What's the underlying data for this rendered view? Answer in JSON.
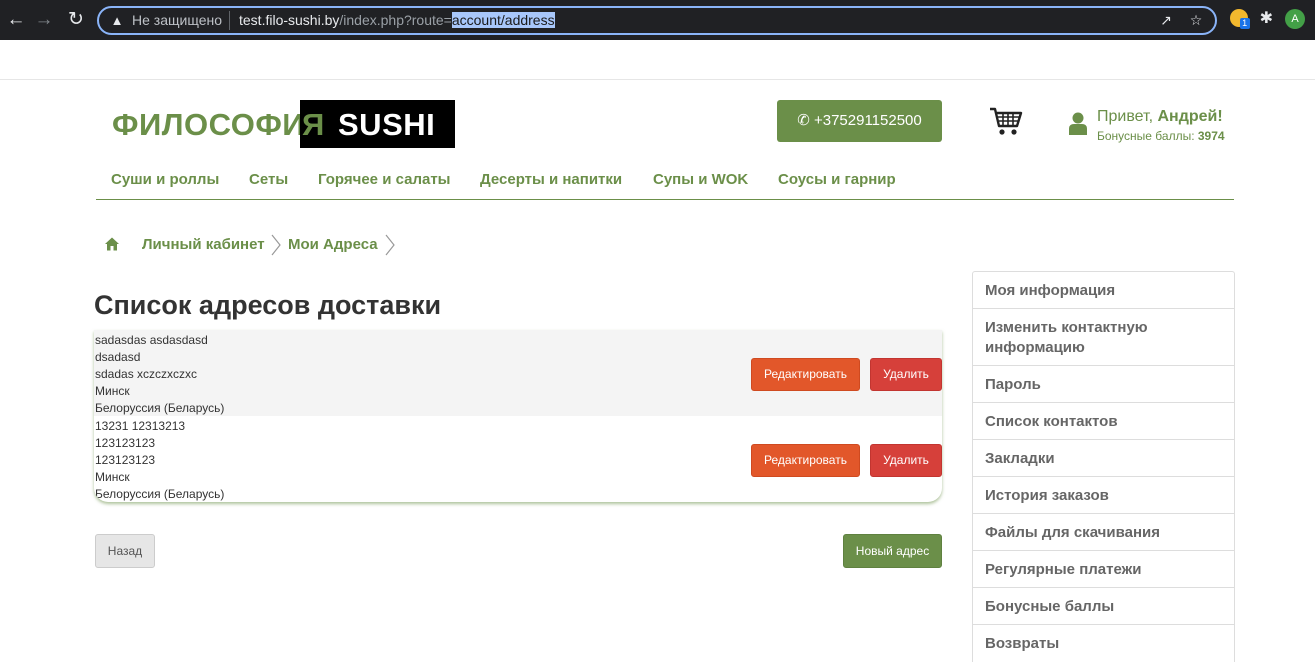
{
  "browser": {
    "not_secure": "Не защищено",
    "url_host": "test.filo-sushi.by",
    "url_path": "/index.php?route=",
    "url_selected": "account/address",
    "profile_initial": "A",
    "extension_badge": "1"
  },
  "header": {
    "logo_green": "ФИЛОСОФИ",
    "logo_ya": "Я",
    "logo_sushi": "SUSHI",
    "phone": "+375291152500",
    "greeting_prefix": "Привет, ",
    "user_name": "Андрей!",
    "bonus_label": "Бонусные баллы: ",
    "bonus_value": "3974"
  },
  "menu": [
    "Суши и роллы",
    "Сеты",
    "Горячее и салаты",
    "Десерты и напитки",
    "Супы и WOK",
    "Соусы и гарнир"
  ],
  "breadcrumb": [
    "Личный кабинет",
    "Мои Адреса"
  ],
  "page_title": "Список адресов доставки",
  "addresses": [
    {
      "lines": [
        "sadasdas asdasdasd",
        "dsadasd",
        "sdadas xczczxczxc",
        "Минск",
        "Белоруссия (Беларусь)"
      ],
      "edit_label": "Редактировать",
      "delete_label": "Удалить"
    },
    {
      "lines": [
        "13231 12313213",
        "123123123",
        "123123123",
        "Минск",
        "Белоруссия (Беларусь)"
      ],
      "edit_label": "Редактировать",
      "delete_label": "Удалить"
    }
  ],
  "buttons": {
    "back": "Назад",
    "new_address": "Новый адрес"
  },
  "sidebar": [
    "Моя информация",
    "Изменить контактную информацию",
    "Пароль",
    "Список контактов",
    "Закладки",
    "История заказов",
    "Файлы для скачивания",
    "Регулярные платежи",
    "Бонусные баллы",
    "Возвраты"
  ],
  "colors": {
    "brand_green": "#6b8f49",
    "edit_orange": "#e2572a",
    "delete_red": "#d6403a"
  }
}
